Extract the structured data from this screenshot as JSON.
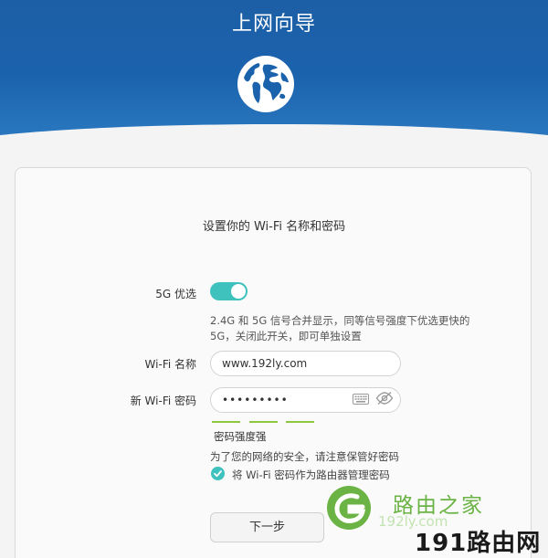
{
  "header": {
    "title": "上网向导",
    "globe_icon": "globe-icon"
  },
  "wifi_setup": {
    "heading": "设置你的 Wi-Fi 名称和密码",
    "priority_5g": {
      "label": "5G 优选",
      "enabled": true,
      "description_line1": "2.4G 和 5G 信号合并显示，同等信号强度下优选更快的",
      "description_line2": "5G，关闭此开关，即可单独设置"
    },
    "wifi_name": {
      "label": "Wi-Fi 名称",
      "value": "www.192ly.com"
    },
    "wifi_password": {
      "label": "新 Wi-Fi 密码",
      "value": "•••••••••",
      "strength_label": "密码强度强"
    },
    "security_note": "为了您的网络的安全，请注意保管好密码",
    "use_as_admin": {
      "label": "将 Wi-Fi 密码作为路由器管理密码",
      "checked": true
    },
    "next_button": "下一步"
  },
  "watermark": {
    "top_text": "路由之家",
    "url_text": "192ly.com",
    "bottom_text": "191路由网"
  },
  "colors": {
    "header_blue": "#1b62ad",
    "accent_teal": "#3fc1bd",
    "strength_green": "#8dc63f",
    "watermark_green": "#6ab344"
  }
}
